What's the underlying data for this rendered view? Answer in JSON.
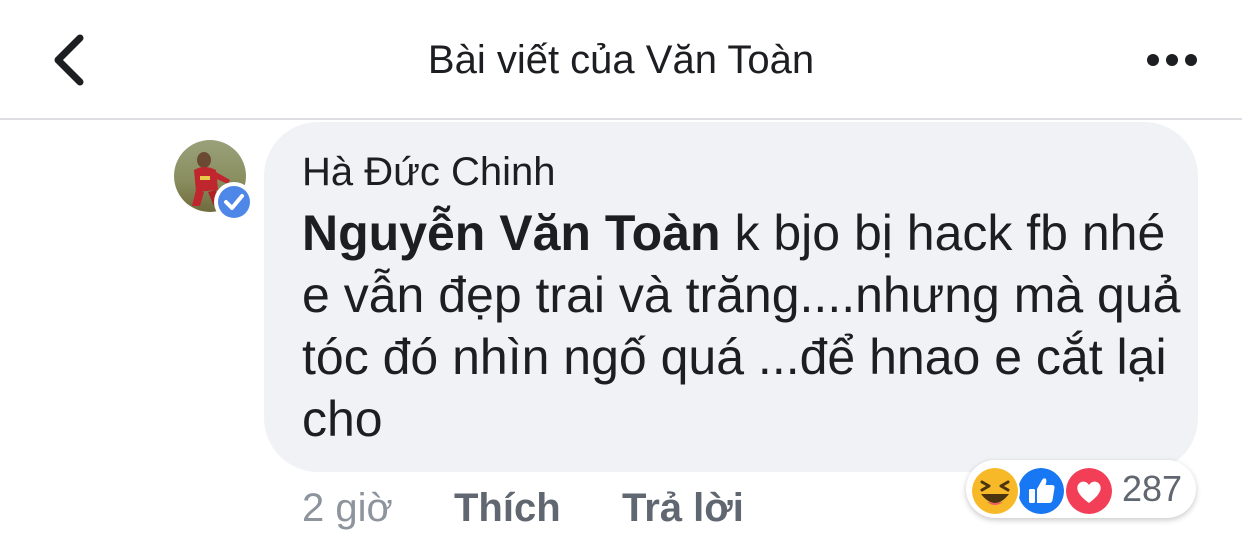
{
  "header": {
    "title": "Bài viết của Văn Toàn",
    "back_icon": "chevron-left-icon",
    "more_icon": "more-horizontal-icon"
  },
  "comment": {
    "author": "Hà Đức Chinh",
    "mention": "Nguyễn Văn Toàn",
    "text": "  k bjo bị hack fb nhé e vẫn đẹp trai và trăng....nhưng mà quả tóc đó nhìn ngố quá ...để hnao e cắt lại cho",
    "time": "2 giờ",
    "like_label": "Thích",
    "reply_label": "Trả lời",
    "reactions": {
      "types": [
        "haha",
        "like",
        "love"
      ],
      "count": "287"
    }
  },
  "colors": {
    "bubble": "#f0f2f5",
    "like_blue": "#1877f2",
    "love_red": "#f33e58",
    "haha_yellow": "#f7b928",
    "verified_blue": "#4f87e8"
  }
}
